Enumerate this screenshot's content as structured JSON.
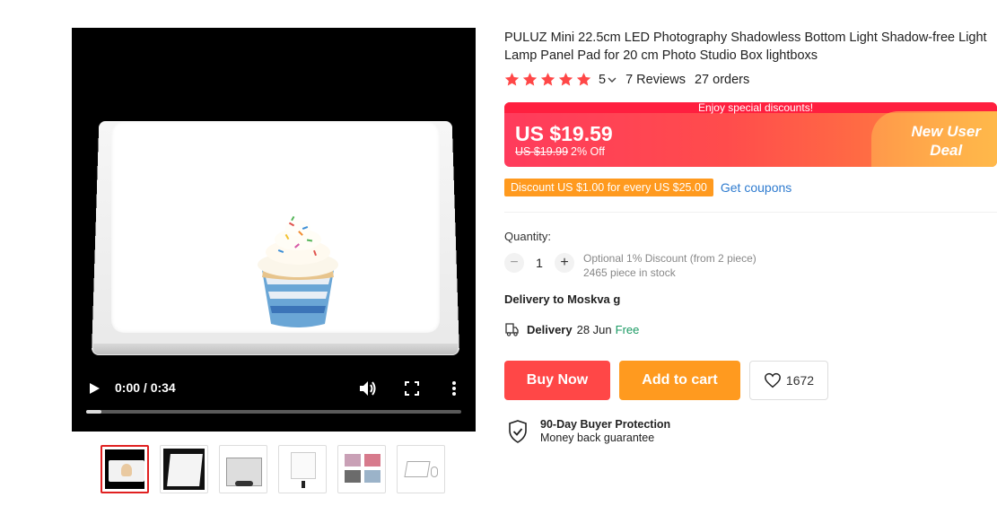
{
  "video": {
    "time": "0:00 / 0:34",
    "progress_fraction": 0.04
  },
  "thumbnails": [
    {
      "name": "cupcake-on-lightpad"
    },
    {
      "name": "lightpad-angle"
    },
    {
      "name": "photo-studio-box"
    },
    {
      "name": "lightpad-on-stand"
    },
    {
      "name": "product-collage"
    },
    {
      "name": "package-contents"
    }
  ],
  "product": {
    "title": "PULUZ Mini 22.5cm LED Photography Shadowless Bottom Light Shadow-free Light Lamp Panel Pad for 20 cm Photo Studio Box lightboxs",
    "rating": "5",
    "reviews": "7 Reviews",
    "orders": "27 orders",
    "star_color": "#ff4747"
  },
  "price_box": {
    "banner": "Enjoy special discounts!",
    "price": "US $19.59",
    "old_price": "US $19.99",
    "off": "2% Off",
    "deal_line1": "New User",
    "deal_line2": "Deal"
  },
  "discount": {
    "tag": "Discount US $1.00 for every US $25.00",
    "link": "Get coupons"
  },
  "quantity": {
    "label": "Quantity:",
    "value": "1",
    "minus": "−",
    "plus": "+",
    "note1": "Optional 1% Discount (from 2 piece)",
    "note2": "2465 piece in stock"
  },
  "delivery": {
    "to": "Delivery to Moskva g",
    "label": "Delivery",
    "date": "28 Jun",
    "free": "Free"
  },
  "actions": {
    "buy_now": "Buy Now",
    "add_to_cart": "Add to cart",
    "wishlist_count": "1672"
  },
  "protection": {
    "title": "90-Day Buyer Protection",
    "subtitle": "Money back guarantee"
  },
  "colors": {
    "brand_red": "#ff4747",
    "orange": "#ff9a1f",
    "link_blue": "#2e7bcf",
    "free_green": "#1a9a63"
  }
}
